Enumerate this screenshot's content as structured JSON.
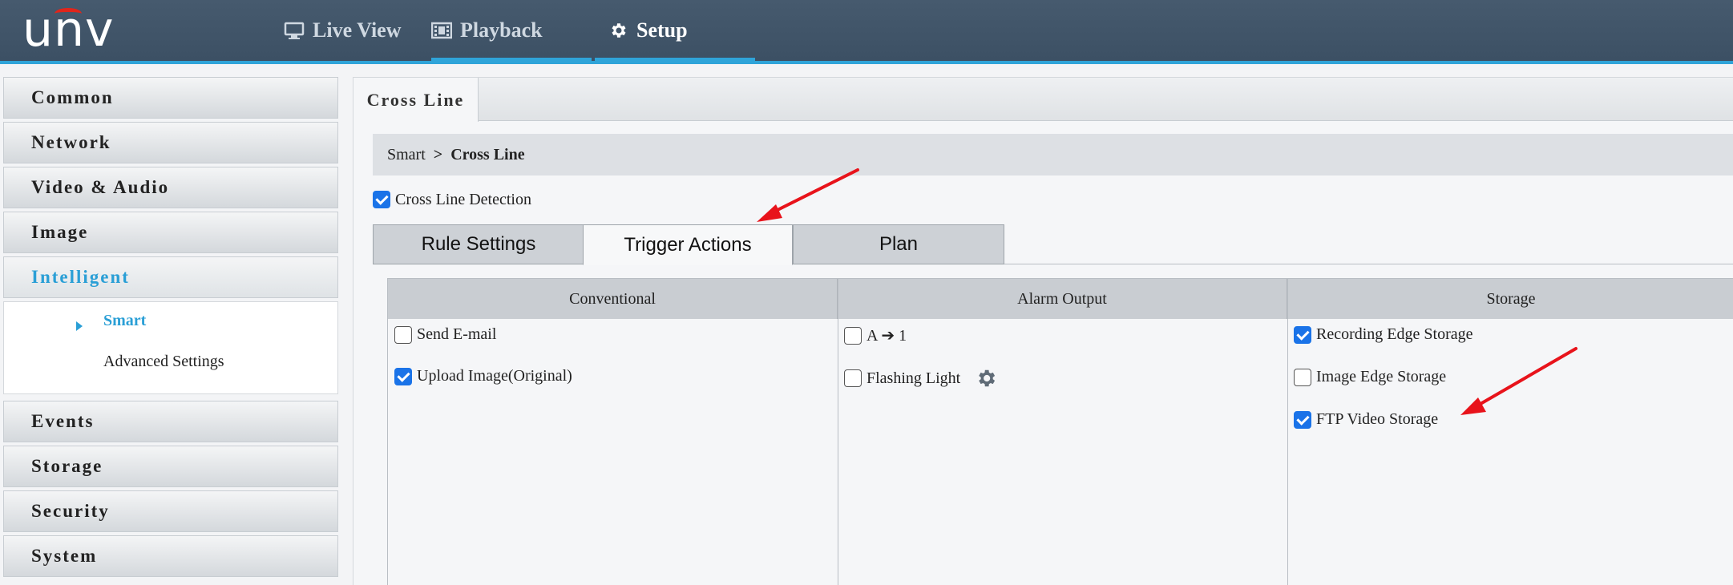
{
  "brand": {
    "logo_text": "unv"
  },
  "nav": [
    {
      "label": "Live View",
      "icon": "monitor-icon"
    },
    {
      "label": "Playback",
      "icon": "film-icon"
    },
    {
      "label": "Setup",
      "icon": "gear-icon",
      "active": true
    }
  ],
  "sidebar": {
    "items": [
      {
        "label": "Common"
      },
      {
        "label": "Network"
      },
      {
        "label": "Video & Audio"
      },
      {
        "label": "Image"
      },
      {
        "label": "Intelligent",
        "active": true
      },
      {
        "label": "Events"
      },
      {
        "label": "Storage"
      },
      {
        "label": "Security"
      },
      {
        "label": "System"
      }
    ],
    "subitems": [
      {
        "label": "Smart",
        "active": true
      },
      {
        "label": "Advanced Settings"
      }
    ]
  },
  "main": {
    "tab_label": "Cross Line",
    "breadcrumb": {
      "parent": "Smart",
      "separator": ">",
      "current": "Cross Line"
    },
    "detection": {
      "label": "Cross Line Detection",
      "checked": true
    },
    "tabs": [
      {
        "label": "Rule Settings"
      },
      {
        "label": "Trigger Actions",
        "active": true
      },
      {
        "label": "Plan"
      }
    ],
    "columns": [
      {
        "header": "Conventional",
        "options": [
          {
            "label": "Send E-mail",
            "checked": false
          },
          {
            "label": "Upload Image(Original)",
            "checked": true
          }
        ]
      },
      {
        "header": "Alarm Output",
        "options": [
          {
            "label": "A ➔ 1",
            "checked": false
          },
          {
            "label": "Flashing Light",
            "checked": false
          }
        ]
      },
      {
        "header": "Storage",
        "options": [
          {
            "label": "Recording Edge Storage",
            "checked": true
          },
          {
            "label": "Image Edge Storage",
            "checked": false
          },
          {
            "label": "FTP Video Storage",
            "checked": true
          }
        ]
      }
    ]
  },
  "colors": {
    "accent": "#2fa4d9",
    "topbar": "#3f5367",
    "annotation_arrow": "#e8131b",
    "checkbox": "#1a73e8"
  }
}
